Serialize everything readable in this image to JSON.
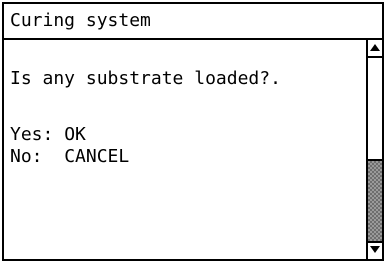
{
  "window": {
    "title": "Curing system"
  },
  "dialog": {
    "question": "Is any substrate loaded?.",
    "options": [
      {
        "label": "Yes:",
        "action": "OK"
      },
      {
        "label": "No:",
        "action": "CANCEL"
      }
    ]
  },
  "scrollbar": {
    "up_icon": "scroll-up-arrow-icon",
    "down_icon": "scroll-down-arrow-icon",
    "position": 1.0
  },
  "colors": {
    "foreground": "#000000",
    "background": "#ffffff",
    "scroll_thumb": "#8a8a8a"
  }
}
